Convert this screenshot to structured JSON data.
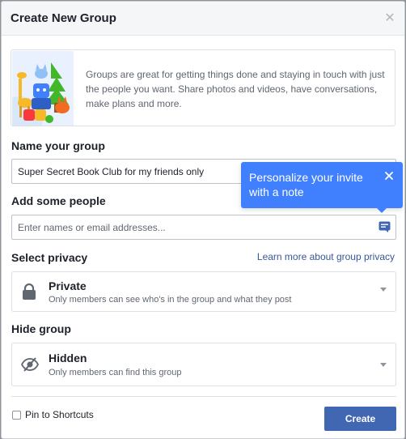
{
  "dialog": {
    "title": "Create New Group",
    "close_icon": "close-icon"
  },
  "intro": {
    "text": "Groups are great for getting things done and staying in touch with just the people you want. Share photos and videos, have conversations, make plans and more."
  },
  "name_section": {
    "label": "Name your group",
    "value": "Super Secret Book Club for my friends only"
  },
  "people_section": {
    "label": "Add some people",
    "placeholder": "Enter names or email addresses...",
    "note_icon": "personalize-note-icon"
  },
  "tooltip": {
    "text": "Personalize your invite with a note"
  },
  "privacy_section": {
    "label": "Select privacy",
    "link": "Learn more about group privacy",
    "option_title": "Private",
    "option_desc": "Only members can see who's in the group and what they post",
    "icon": "lock-icon"
  },
  "hide_section": {
    "label": "Hide group",
    "option_title": "Hidden",
    "option_desc": "Only members can find this group",
    "icon": "hidden-eye-icon"
  },
  "footer": {
    "pin_label": "Pin to Shortcuts",
    "pin_checked": false,
    "create_label": "Create"
  },
  "colors": {
    "accent": "#4267b2",
    "tooltip": "#4080ff",
    "link": "#365899"
  }
}
